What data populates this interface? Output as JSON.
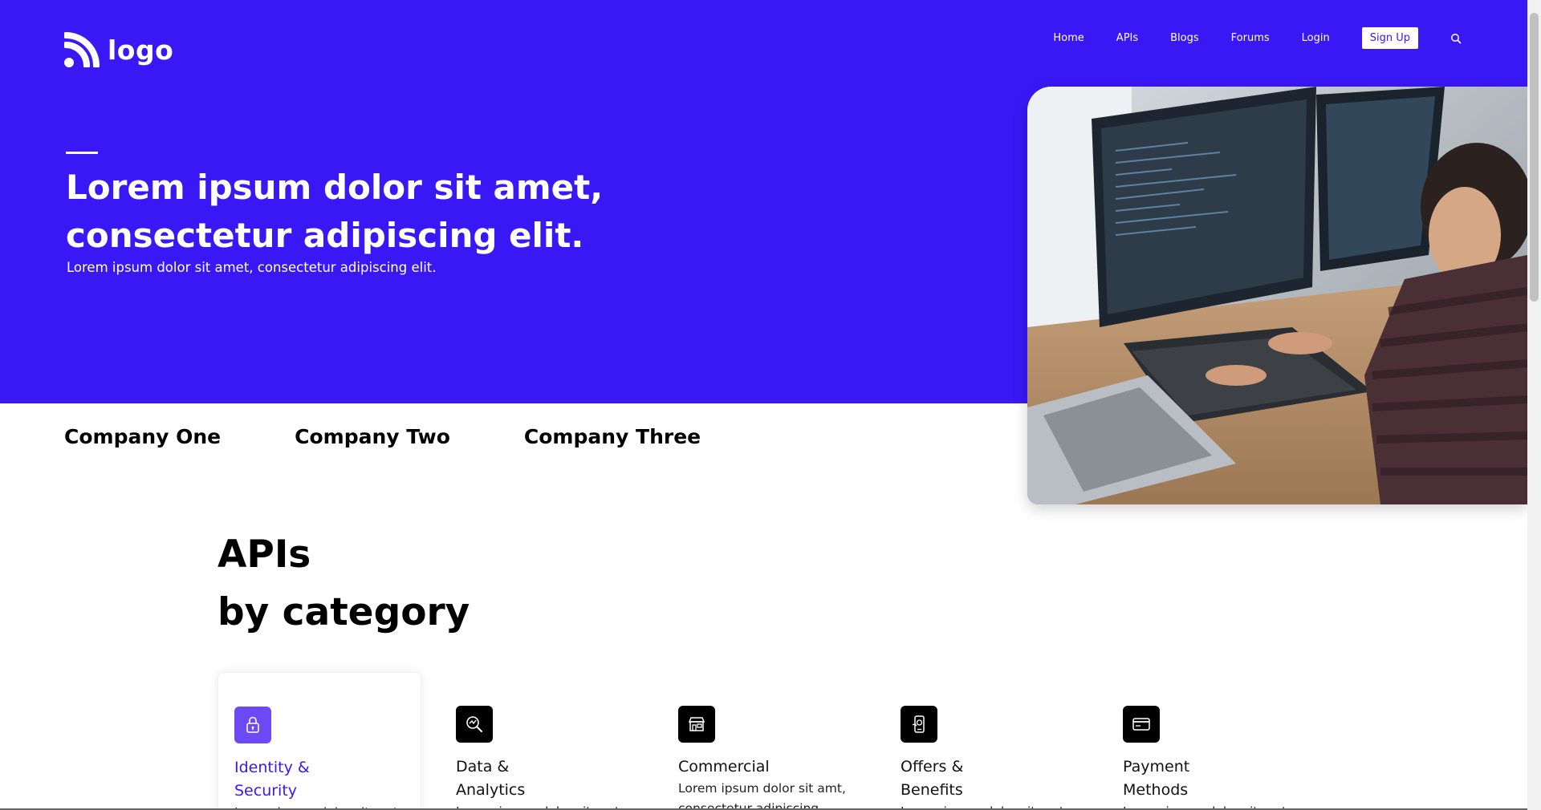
{
  "brand": {
    "logo_text": "logo",
    "accent": "#3a17f5",
    "icon": "rss-icon"
  },
  "nav": {
    "items": [
      "Home",
      "APIs",
      "Blogs",
      "Forums",
      "Login"
    ],
    "signup_label": "Sign Up",
    "search_icon": "search-icon"
  },
  "hero": {
    "title": "Lorem ipsum dolor sit amet, consectetur adipiscing elit.",
    "subtitle": "Lorem ipsum dolor sit amet, consectetur adipiscing elit."
  },
  "companies": [
    "Company One",
    "Company Two",
    "Company Three"
  ],
  "apis": {
    "title_line1": "APIs",
    "title_line2": "by category"
  },
  "categories": [
    {
      "title": "Identity & Security",
      "desc": "Lorem ipsum dolor sit amt,",
      "icon": "lock-icon",
      "active": true
    },
    {
      "title": "Data & Analytics",
      "desc": "Lorem ipsum dolor sit amt,",
      "icon": "magnifier-chart-icon",
      "active": false
    },
    {
      "title": "Commercial",
      "desc": "Lorem ipsum dolor sit amt, consectetur adipiscing.",
      "icon": "store-icon",
      "active": false
    },
    {
      "title": "Offers & Benefits",
      "desc": "Lorem ipsum dolor sit amt,",
      "icon": "mobile-offer-icon",
      "active": false
    },
    {
      "title": "Payment Methods",
      "desc": "Lorem ipsum dolor sit amt,",
      "icon": "credit-card-icon",
      "active": false
    }
  ]
}
